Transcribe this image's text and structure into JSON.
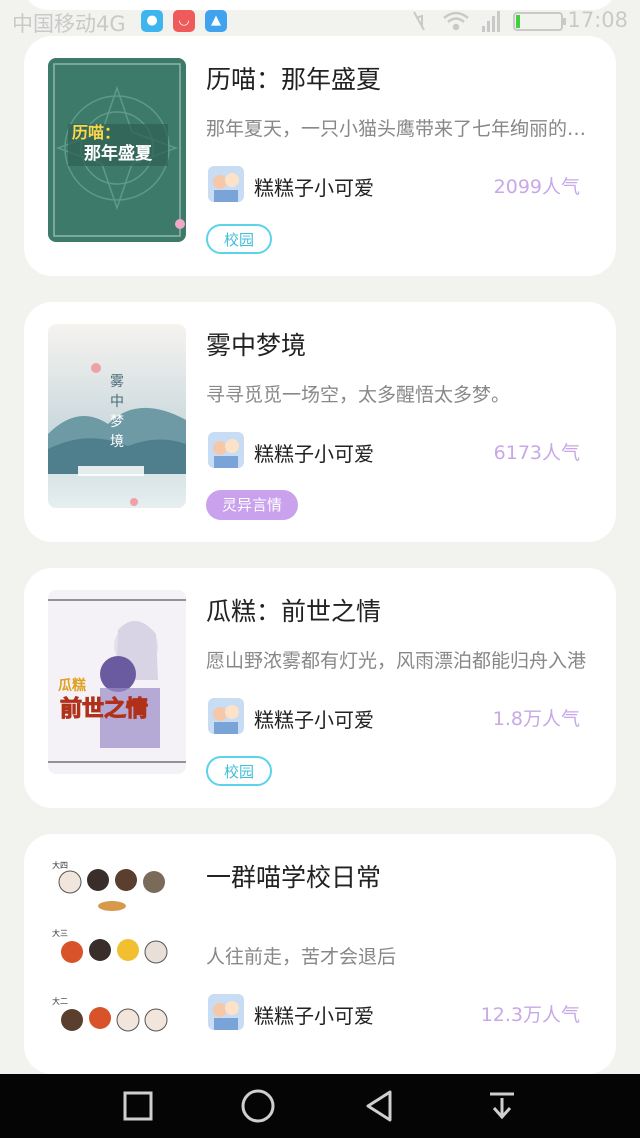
{
  "status_bar": {
    "carrier": "中国移动4G",
    "time": "17:08",
    "app_icons": [
      {
        "name": "location-app-icon",
        "color": "#3fb5ef"
      },
      {
        "name": "shop-app-icon",
        "color": "#ef5a5a"
      },
      {
        "name": "gallery-app-icon",
        "color": "#3fa3ef"
      }
    ]
  },
  "books": [
    {
      "title": "历喵：那年盛夏",
      "description": "那年夏天，一只小猫头鹰带来了七年绚丽的时光",
      "author": "糕糕子小可爱",
      "popularity": "2099人气",
      "tag": "校园",
      "tag_style": "outline",
      "cover_text": [
        "历喵：",
        "那年盛夏"
      ]
    },
    {
      "title": "雾中梦境",
      "description": "寻寻觅觅一场空，太多醒悟太多梦。",
      "author": "糕糕子小可爱",
      "popularity": "6173人气",
      "tag": "灵异言情",
      "tag_style": "filled",
      "cover_text": [
        "雾",
        "中",
        "梦",
        "境"
      ]
    },
    {
      "title": "瓜糕：前世之情",
      "description": "愿山野浓雾都有灯光，风雨漂泊都能归舟入港",
      "author": "糕糕子小可爱",
      "popularity": "1.8万人气",
      "tag": "校园",
      "tag_style": "outline",
      "cover_text": [
        "瓜糕",
        "前世之情"
      ]
    },
    {
      "title": "一群喵学校日常",
      "description": "人往前走，苦才会退后",
      "author": "糕糕子小可爱",
      "popularity": "12.3万人气",
      "tag": "",
      "tag_style": "none",
      "cover_text": [
        "大四",
        "大三",
        "大二"
      ]
    }
  ],
  "colors": {
    "background": "#f2f2ee",
    "popularity": "#c8a8e8",
    "tag_outline": "#5bd3ea",
    "tag_filled": "#c9a1ec"
  },
  "nav_bar": [
    "recent-apps-button",
    "home-button",
    "back-button",
    "notification-button"
  ]
}
